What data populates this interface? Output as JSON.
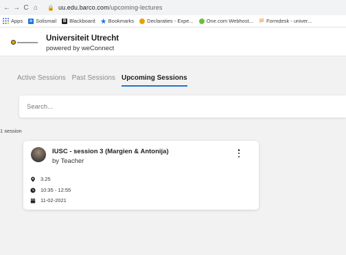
{
  "browser": {
    "nav": {
      "back": "←",
      "forward": "→",
      "reload": "C",
      "home": "⌂"
    },
    "url_host": "uu.edu.barco.com",
    "url_path": "/upcoming-lectures",
    "bookmarks": [
      {
        "label": "Apps",
        "icon": "apps-grid-icon"
      },
      {
        "label": "Solismail",
        "icon": "solismail-icon"
      },
      {
        "label": "Blackboard",
        "icon": "blackboard-icon"
      },
      {
        "label": "Bookmarks",
        "icon": "star-icon"
      },
      {
        "label": "Declaraties - Expe...",
        "icon": "declaraties-icon"
      },
      {
        "label": "One.com Webhost...",
        "icon": "onecom-icon"
      },
      {
        "label": "Formdesk - univer...",
        "icon": "formdesk-icon"
      }
    ]
  },
  "header": {
    "org_name": "Universiteit Utrecht",
    "org_sub": "powered by weConnect"
  },
  "tabs": [
    {
      "label": "Active Sessions",
      "active": false
    },
    {
      "label": "Past Sessions",
      "active": false
    },
    {
      "label": "Upcoming Sessions",
      "active": true
    }
  ],
  "search": {
    "placeholder": "Search...",
    "value": ""
  },
  "result_count": "1 session",
  "sessions": [
    {
      "title": "IUSC - session 3 (Margien & Antonija)",
      "subtitle": "by Teacher",
      "location": "3.25",
      "time": "10:35 - 12:55",
      "date": "11-02-2021"
    }
  ],
  "colors": {
    "accent": "#1a73c9",
    "background": "#f2f2f2",
    "card": "#ffffff"
  }
}
